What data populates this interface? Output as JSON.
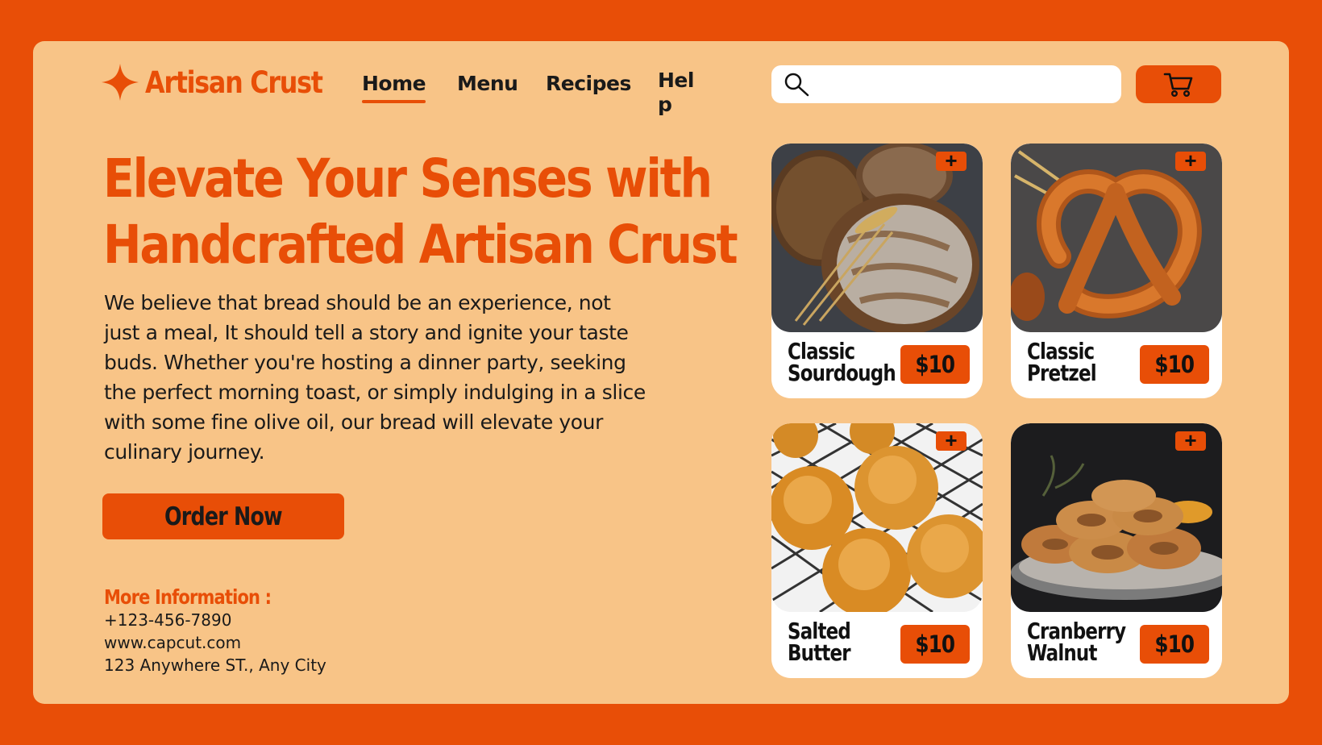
{
  "brand": {
    "name": "Artisan Crust",
    "accent_color": "#E84E07",
    "panel_color": "#F8C487"
  },
  "nav": {
    "items": [
      "Home",
      "Menu",
      "Recipes",
      "Help"
    ],
    "active": "Home"
  },
  "search": {
    "placeholder": "",
    "icon": "search-icon"
  },
  "cart": {
    "icon": "cart-icon"
  },
  "hero": {
    "headline_line1": "Elevate Your Senses with",
    "headline_line2": "Handcrafted Artisan Crust",
    "body": "We believe that bread should be an experience, not just a meal, It should tell a story and ignite your taste buds. Whether you're hosting a dinner party, seeking the perfect morning toast, or simply indulging in a slice with some fine olive oil, our bread will elevate your culinary journey.",
    "cta": "Order Now"
  },
  "info": {
    "title": "More Information :",
    "phone": "+123-456-7890",
    "website": "www.capcut.com",
    "address": "123 Anywhere ST., Any City"
  },
  "products": [
    {
      "name": "Classic Sourdough",
      "price": "$10",
      "add_label": "+"
    },
    {
      "name": "Classic Pretzel",
      "price": "$10",
      "add_label": "+"
    },
    {
      "name": "Salted Butter",
      "price": "$10",
      "add_label": "+"
    },
    {
      "name": "Cranberry Walnut",
      "price": "$10",
      "add_label": "+"
    }
  ]
}
